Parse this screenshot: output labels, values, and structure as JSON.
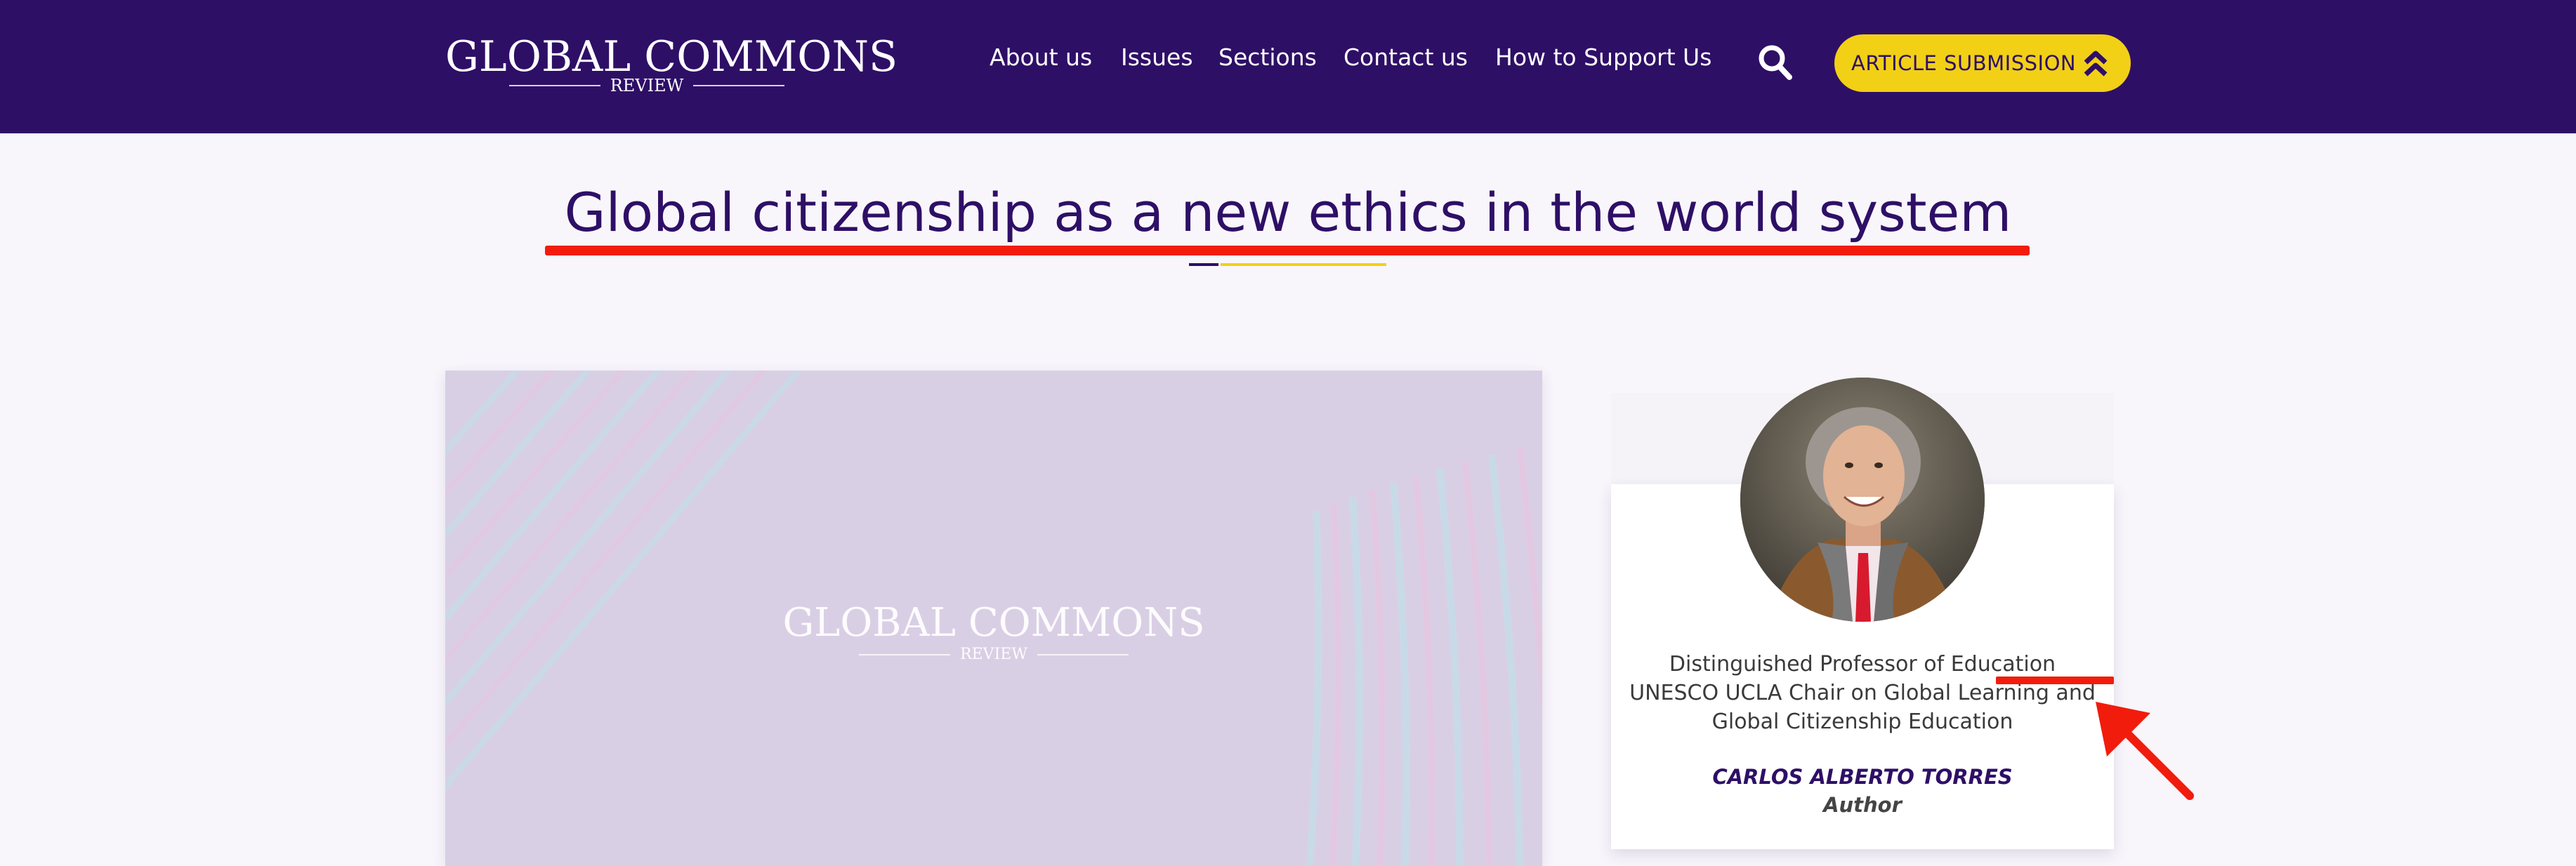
{
  "header": {
    "logo_main": "GLOBAL COMMONS",
    "logo_sub": "REVIEW",
    "nav": [
      "About us",
      "Issues",
      "Sections",
      "Contact us",
      "How to Support Us"
    ],
    "search_icon": "search-icon",
    "submit_label": "ARTICLE SUBMISSION",
    "submit_icon": "double-chevron-up-icon"
  },
  "article": {
    "title": "Global citizenship as a new ethics in the world system"
  },
  "hero": {
    "logo_main": "GLOBAL COMMONS",
    "logo_sub": "REVIEW"
  },
  "author": {
    "description": "Distinguished Professor of Education UNESCO UCLA Chair on Global Learning and Global Citizenship Education",
    "name": "CARLOS ALBERTO TORRES",
    "role": "Author"
  },
  "colors": {
    "header_bg": "#2e0f66",
    "accent_yellow": "#f2d016",
    "annotation_red": "#f21c0c",
    "hero_bg": "#d9cfe5"
  }
}
